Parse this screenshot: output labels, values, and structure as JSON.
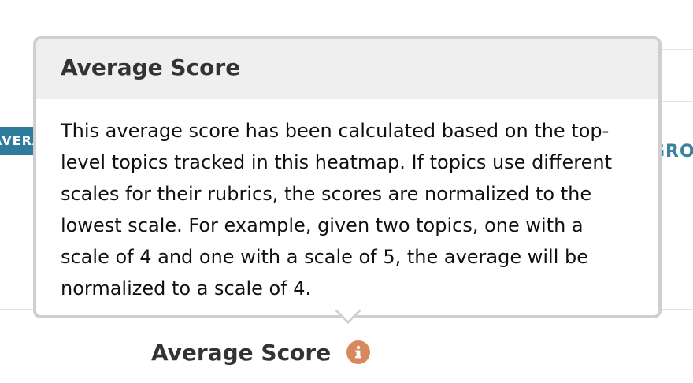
{
  "background": {
    "left_badge_text": "AVERAGE",
    "right_header_text": "GROUP"
  },
  "popover": {
    "title": "Average Score",
    "body": "This average score has been calculated based on the top-level topics tracked in this heatmap. If topics use different scales for their rubrics, the scores are normalized to the lowest scale. For example, given two topics, one with a scale of 4 and one with a scale of 5, the average will be normalized to a scale of 4."
  },
  "column_header": {
    "label": "Average Score",
    "icon": "info-icon"
  },
  "colors": {
    "info_icon": "#d9875f",
    "badge": "#2e7b9c",
    "header_bg": "#efefef",
    "popover_border": "#cfcfcf"
  }
}
